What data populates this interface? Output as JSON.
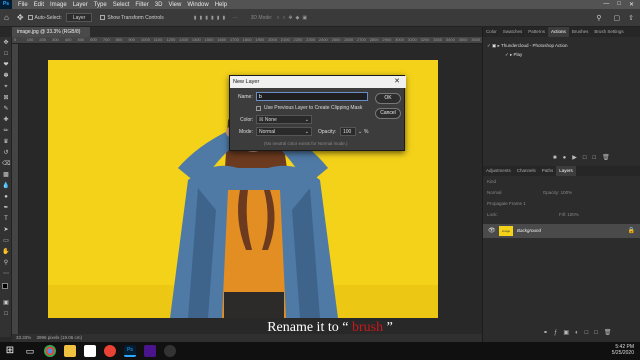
{
  "menubar": {
    "app_icon": "Ps",
    "items": [
      "File",
      "Edit",
      "Image",
      "Layer",
      "Type",
      "Select",
      "Filter",
      "3D",
      "View",
      "Window",
      "Help"
    ]
  },
  "options_bar": {
    "auto_select": "Auto-Select:",
    "layer_dropdown": "Layer",
    "show_transform": "Show Transform Controls",
    "mode_3d": "3D Mode:"
  },
  "document": {
    "tab_title": "image.jpg @ 33.3% (RGB/8) *",
    "ruler_ticks": [
      "0",
      "100",
      "200",
      "300",
      "400",
      "500",
      "600",
      "700",
      "800",
      "900",
      "1000",
      "1100",
      "1200",
      "1300",
      "1400",
      "1500",
      "1600",
      "1700",
      "1800",
      "1900",
      "2000",
      "2100",
      "2200",
      "2300",
      "2400",
      "2500",
      "2600",
      "2700",
      "2800",
      "2900",
      "3000",
      "3100",
      "3200",
      "3300",
      "3400",
      "3500",
      "3600"
    ],
    "zoom": "33.33%",
    "doc_info": "3996 pixels (19.06 cm)"
  },
  "panels": {
    "top_tabs": [
      "Color",
      "Swatches",
      "Patterns",
      "Actions",
      "Brushes",
      "Brush Settings"
    ],
    "active_top": "Actions",
    "actions": [
      "Thundercloud - Photoshop Action",
      "Play"
    ],
    "layer_tabs": [
      "Adjustments",
      "Channels",
      "Paths",
      "Layers"
    ],
    "active_layer_tab": "Layers",
    "kind": "Kind",
    "blend": "Normal",
    "opacity_label": "Opacity:",
    "opacity_value": "100%",
    "lock_label": "Lock:",
    "fill_label": "Fill:",
    "fill_value": "100%",
    "prevent_label": "Propagate Frame 1",
    "layer_name": "Background",
    "layer_thumb_label": "image"
  },
  "dialog": {
    "title": "New Layer",
    "name_label": "Name:",
    "name_value": "b",
    "clipping_label": "Use Previous Layer to Create Clipping Mask",
    "color_label": "Color:",
    "color_value": "None",
    "mode_label": "Mode:",
    "mode_value": "Normal",
    "opacity_label": "Opacity:",
    "opacity_value": "100",
    "percent": "%",
    "neutral_text": "(No neutral color exists for Normal mode.)",
    "ok": "OK",
    "cancel": "Cancel"
  },
  "caption": {
    "prefix": "Rename it to ",
    "open_quote": "“",
    "word": " brush",
    "close_quote": " ”"
  },
  "taskbar": {
    "time": "5:42 PM",
    "date": "5/25/2020"
  },
  "colors": {
    "canvas_bg": "#f4d21a",
    "caption_accent": "#c8191e",
    "ps_blue": "#31a8ff"
  }
}
